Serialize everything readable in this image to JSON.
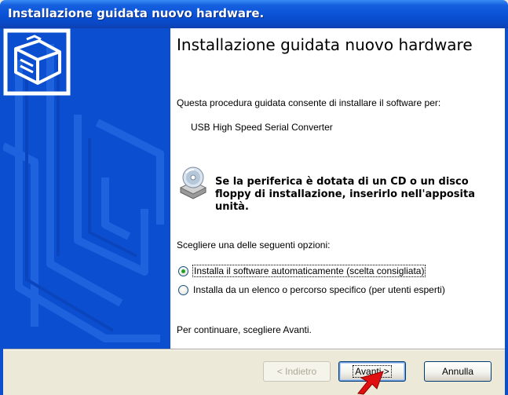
{
  "window": {
    "title": "Installazione guidata nuovo hardware."
  },
  "wizard": {
    "heading": "Installazione guidata nuovo hardware",
    "intro": "Questa procedura guidata consente di installare il software per:",
    "device_name": "USB High Speed Serial Converter",
    "cd_note_line1": "Se la periferica è dotata di un CD o un disco",
    "cd_note_line2": "floppy di installazione, inserirlo nell'apposita",
    "cd_note_line3": "unità.",
    "options_prompt": "Scegliere una delle seguenti opzioni:",
    "options": [
      {
        "label": "Installa il software automaticamente (scelta consigliata)",
        "selected": true
      },
      {
        "label": "Installa da un elenco o percorso specifico (per utenti esperti)",
        "selected": false
      }
    ],
    "continue_text": "Per continuare, scegliere Avanti."
  },
  "buttons": {
    "back": "< Indietro",
    "next": "Avanti >",
    "cancel": "Annulla"
  },
  "icons": {
    "hardware": "hardware-wizard-icon",
    "cd": "cd-disk-icon",
    "cursor": "mouse-cursor-icon"
  },
  "colors": {
    "titlebar": "#0A51D6",
    "banner": "#0B4FD0",
    "dialog_bg": "#ECE9D8",
    "radio_selected": "#21A121",
    "cursor": "#E01010"
  }
}
